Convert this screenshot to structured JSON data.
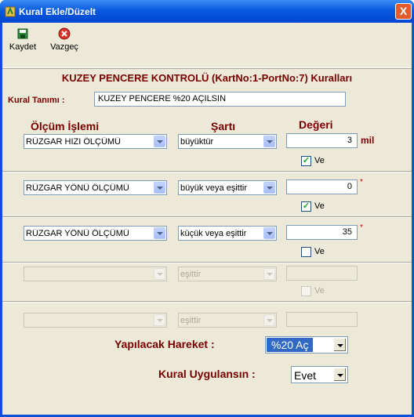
{
  "window": {
    "title": "Kural Ekle/Düzelt",
    "close": "X"
  },
  "toolbar": {
    "save_label": "Kaydet",
    "cancel_label": "Vazgeç"
  },
  "header": "KUZEY PENCERE KONTROLÜ (KartNo:1-PortNo:7) Kuralları",
  "rule_name": {
    "label": "Kural Tanımı :",
    "value": "KUZEY PENCERE %20 AÇILSIN"
  },
  "columns": {
    "operation": "Ölçüm İşlemi",
    "condition": "Şartı",
    "value": "Değeri"
  },
  "rows": [
    {
      "operation": "RÜZGAR HIZI ÖLÇÜMÜ",
      "condition": "büyüktür",
      "value": "3",
      "unit": "mil",
      "and_label": "Ve",
      "and_checked": true
    },
    {
      "operation": "RÜZGAR YÖNÜ ÖLÇÜMÜ",
      "condition": "büyük veya eşittir",
      "value": "0",
      "unit": "*",
      "and_label": "Ve",
      "and_checked": true
    },
    {
      "operation": "RÜZGAR YÖNÜ ÖLÇÜMÜ",
      "condition": "küçük veya eşittir",
      "value": "35",
      "unit": "*",
      "and_label": "Ve",
      "and_checked": false
    },
    {
      "operation": "",
      "condition": "eşittir",
      "value": "",
      "unit": "",
      "and_label": "Ve",
      "and_checked": false
    },
    {
      "operation": "",
      "condition": "eşittir",
      "value": "",
      "unit": "",
      "and_label": "",
      "and_checked": false
    }
  ],
  "action": {
    "label": "Yapılacak Hareket :",
    "value": "%20 Aç"
  },
  "apply": {
    "label": "Kural Uygulansın :",
    "value": "Evet"
  },
  "colors": {
    "title_bar": "#0A5AE0",
    "label_red": "#7A0000",
    "face": "#ECE9D8",
    "highlight": "#316AC5"
  }
}
